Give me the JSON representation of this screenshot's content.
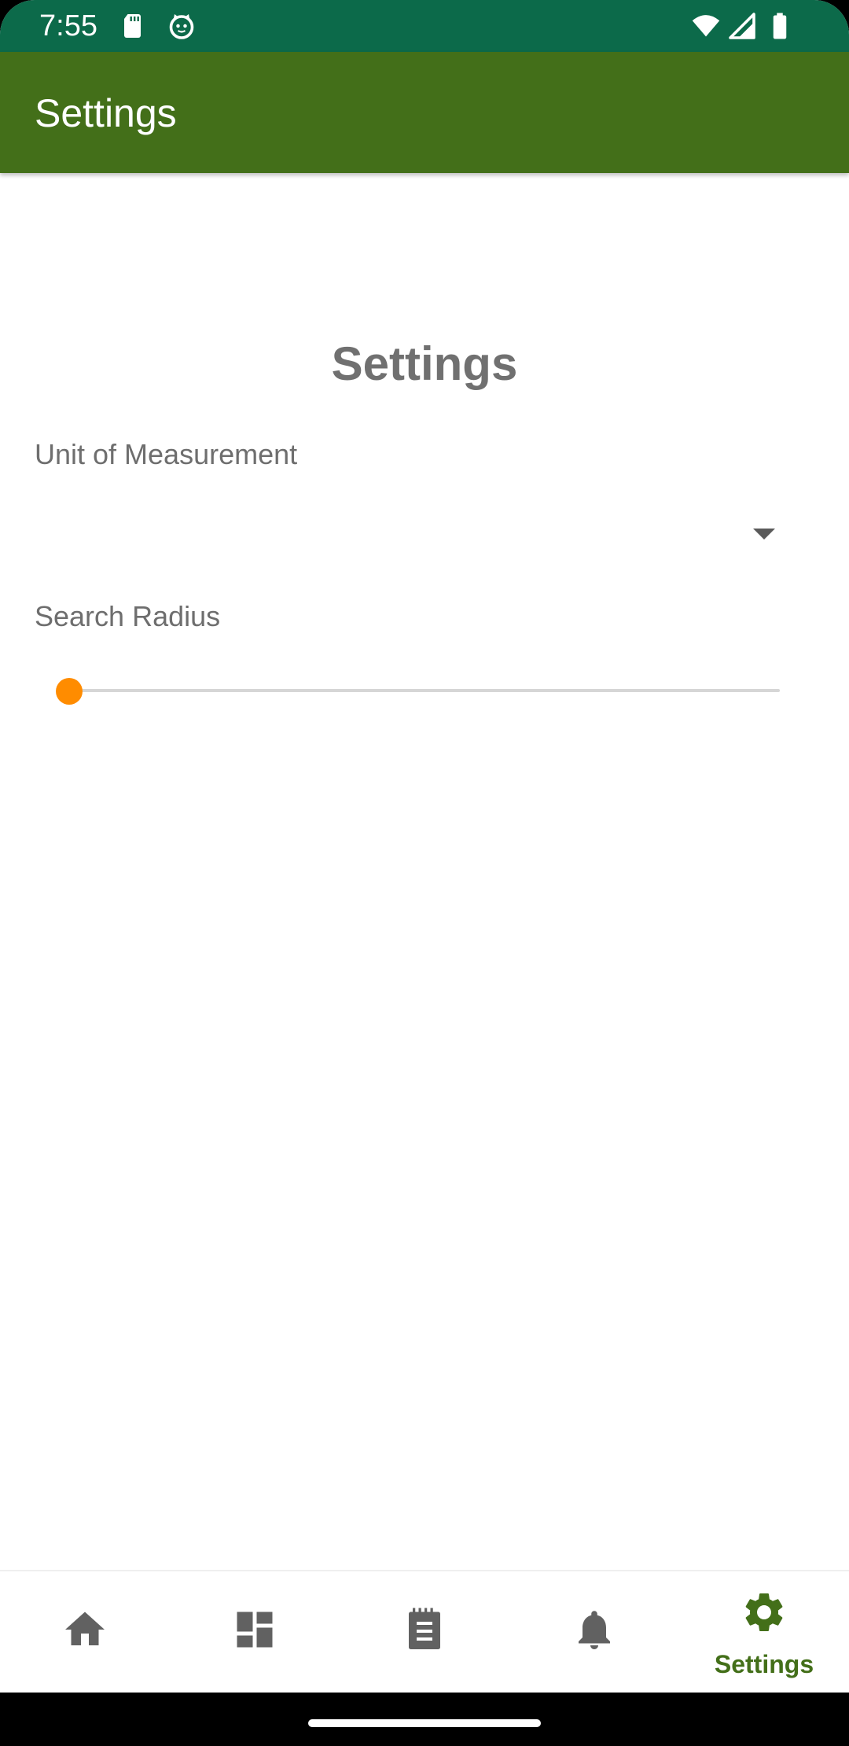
{
  "status_bar": {
    "time": "7:55",
    "icons": [
      "sd-card-icon",
      "cat-face-icon",
      "wifi-icon",
      "cellular-signal-icon",
      "battery-icon"
    ]
  },
  "app_bar": {
    "title": "Settings",
    "color": "#436f19"
  },
  "main": {
    "heading": "Settings",
    "unit_of_measurement": {
      "label": "Unit of Measurement",
      "selected_value": ""
    },
    "search_radius": {
      "label": "Search Radius",
      "value_fraction": 0.0,
      "accent_color": "#ff8c00"
    }
  },
  "bottom_nav": {
    "items": [
      {
        "icon": "home-icon",
        "label": ""
      },
      {
        "icon": "dashboard-icon",
        "label": ""
      },
      {
        "icon": "notepad-icon",
        "label": ""
      },
      {
        "icon": "bell-icon",
        "label": ""
      },
      {
        "icon": "gear-icon",
        "label": "Settings",
        "active": true
      }
    ],
    "active_color": "#436f19",
    "inactive_color": "#616161"
  }
}
